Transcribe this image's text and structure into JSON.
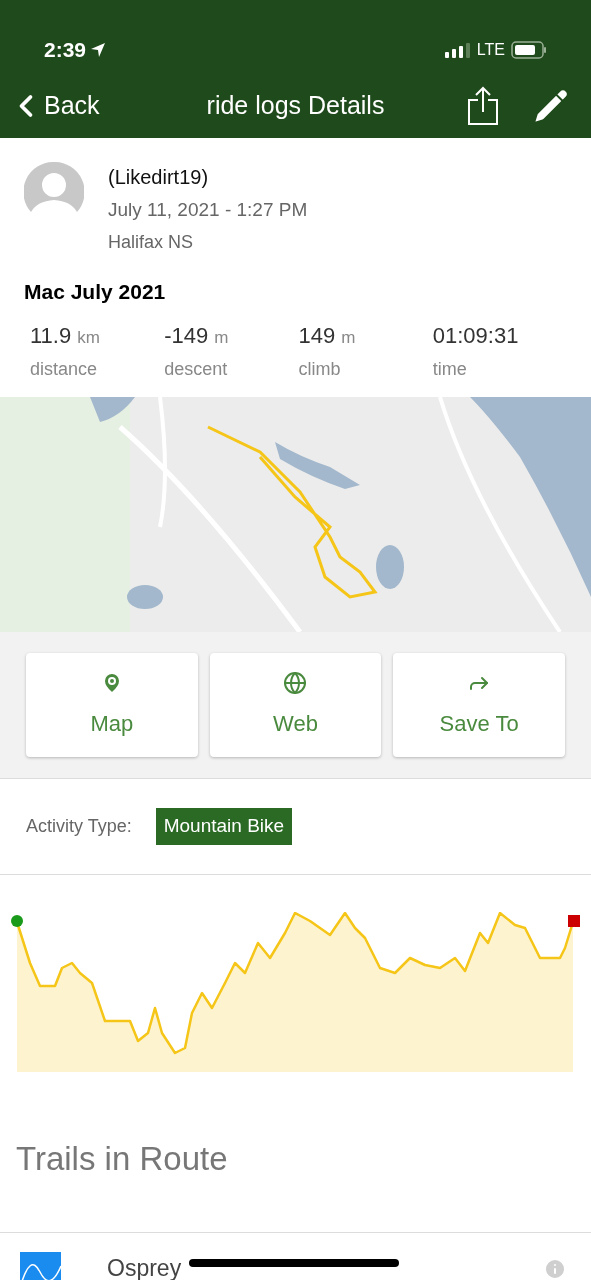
{
  "status_bar": {
    "time": "2:39",
    "network": "LTE"
  },
  "nav": {
    "back": "Back",
    "title": "ride logs Details"
  },
  "profile": {
    "username": "(Likedirt19)",
    "date": "July 11, 2021 - 1:27 PM",
    "location": "Halifax NS"
  },
  "ride_title": "Mac July 2021",
  "stats": [
    {
      "value": "11.9",
      "unit": "km",
      "label": "distance"
    },
    {
      "value": "-149",
      "unit": "m",
      "label": "descent"
    },
    {
      "value": "149",
      "unit": "m",
      "label": "climb"
    },
    {
      "value": "01:09:31",
      "label": "time"
    }
  ],
  "actions": [
    {
      "kind": "pin",
      "label": "Map"
    },
    {
      "kind": "globe",
      "label": "Web"
    },
    {
      "kind": "share",
      "label": "Save To"
    }
  ],
  "activity": {
    "label": "Activity Type:",
    "value": "Mountain Bike"
  },
  "trails_heading": "Trails in Route",
  "trails": [
    {
      "name": "Osprey"
    }
  ]
}
